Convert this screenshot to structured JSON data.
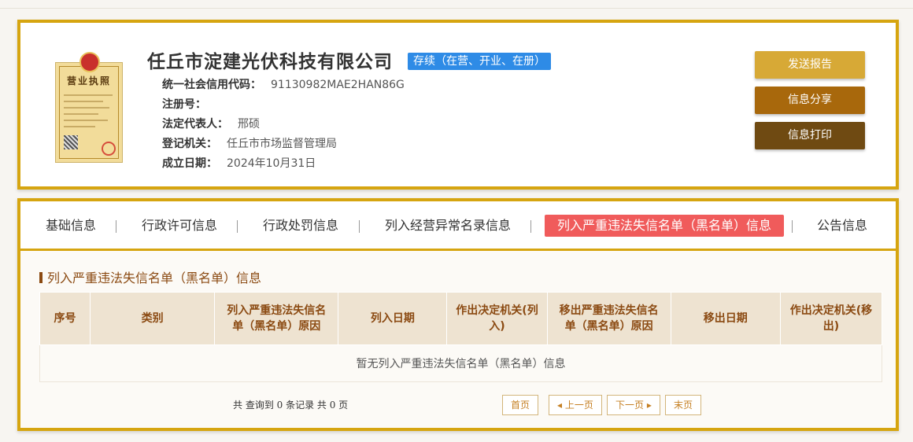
{
  "company": {
    "name": "任丘市淀建光伏科技有限公司",
    "status": "存续（在营、开业、在册）",
    "license_title": "营业执照",
    "fields": [
      {
        "label": "统一社会信用代码：",
        "value": "91130982MAE2HAN86G"
      },
      {
        "label": "注册号：",
        "value": ""
      },
      {
        "label": "法定代表人：",
        "value": "邢硕"
      },
      {
        "label": "登记机关：",
        "value": "任丘市市场监督管理局"
      },
      {
        "label": "成立日期：",
        "value": "2024年10月31日"
      }
    ]
  },
  "actions": {
    "send_report": "发送报告",
    "share": "信息分享",
    "print": "信息打印"
  },
  "tabs": [
    {
      "label": "基础信息"
    },
    {
      "label": "行政许可信息"
    },
    {
      "label": "行政处罚信息"
    },
    {
      "label": "列入经营异常名录信息"
    },
    {
      "label": "列入严重违法失信名单（黑名单）信息",
      "active": true
    },
    {
      "label": "公告信息"
    }
  ],
  "section": {
    "title": "列入严重违法失信名单（黑名单）信息",
    "columns": [
      "序号",
      "类别",
      "列入严重违法失信名单（黑名单）原因",
      "列入日期",
      "作出决定机关(列入)",
      "移出严重违法失信名单（黑名单）原因",
      "移出日期",
      "作出决定机关(移出)"
    ],
    "empty_message": "暂无列入严重违法失信名单（黑名单）信息"
  },
  "pager": {
    "summary": "共 查询到 0 条记录 共 0 页",
    "first": "首页",
    "prev": "◂ 上一页",
    "next": "下一页 ▸",
    "last": "末页"
  },
  "colors": {
    "border_gold": "#d6a510",
    "status_blue": "#2e8be6",
    "active_tab": "#f05b5b",
    "btn_send": "#d7a936",
    "btn_share": "#a8680c",
    "btn_print": "#6f4a12",
    "title_brown": "#8b4a12"
  }
}
